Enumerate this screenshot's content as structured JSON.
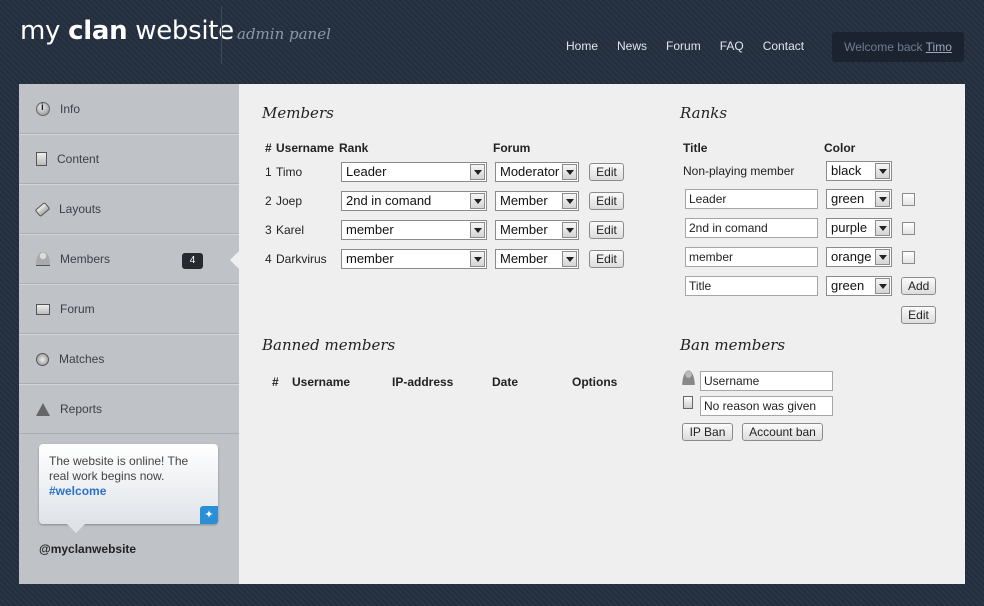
{
  "header": {
    "logo_pre": "my ",
    "logo_bold": "clan",
    "logo_post": " website",
    "subtitle": "admin panel",
    "nav": [
      "Home",
      "News",
      "Forum",
      "FAQ",
      "Contact"
    ],
    "welcome_text": "Welcome back ",
    "welcome_user": "Timo"
  },
  "sidebar": {
    "items": [
      {
        "label": "Info",
        "icon": "info-icon"
      },
      {
        "label": "Content",
        "icon": "document-icon"
      },
      {
        "label": "Layouts",
        "icon": "tag-icon"
      },
      {
        "label": "Members",
        "icon": "user-icon",
        "badge": "4"
      },
      {
        "label": "Forum",
        "icon": "forum-icon"
      },
      {
        "label": "Matches",
        "icon": "medal-icon"
      },
      {
        "label": "Reports",
        "icon": "warning-icon"
      }
    ],
    "tweet_text": "The website is online! The real work begins now.",
    "tweet_tag": "#welcome",
    "tweet_icon": "twitter-icon",
    "handle": "@myclanwebsite"
  },
  "members": {
    "title": "Members",
    "headers": {
      "num": "#",
      "username": "Username",
      "rank": "Rank",
      "forum": "Forum"
    },
    "rows": [
      {
        "num": "1",
        "name": "Timo",
        "rank": "Leader",
        "forum": "Moderator",
        "edit": "Edit"
      },
      {
        "num": "2",
        "name": "Joep",
        "rank": "2nd in comand",
        "forum": "Member",
        "edit": "Edit"
      },
      {
        "num": "3",
        "name": "Karel",
        "rank": "member",
        "forum": "Member",
        "edit": "Edit"
      },
      {
        "num": "4",
        "name": "Darkvirus",
        "rank": "member",
        "forum": "Member",
        "edit": "Edit"
      }
    ]
  },
  "ranks": {
    "title": "Ranks",
    "headers": {
      "title": "Title",
      "color": "Color"
    },
    "default_row": {
      "title": "Non-playing member",
      "color": "black"
    },
    "rows": [
      {
        "title": "Leader",
        "color": "green"
      },
      {
        "title": "2nd in comand",
        "color": "purple"
      },
      {
        "title": "member",
        "color": "orange"
      }
    ],
    "new_row": {
      "placeholder": "Title",
      "color": "green",
      "add": "Add"
    },
    "edit": "Edit"
  },
  "banned": {
    "title": "Banned members",
    "headers": {
      "num": "#",
      "username": "Username",
      "ip": "IP-address",
      "date": "Date",
      "options": "Options"
    }
  },
  "ban": {
    "title": "Ban members",
    "username_value": "Username",
    "reason_value": "No reason was given",
    "ip_ban": "IP Ban",
    "account_ban": "Account ban"
  }
}
